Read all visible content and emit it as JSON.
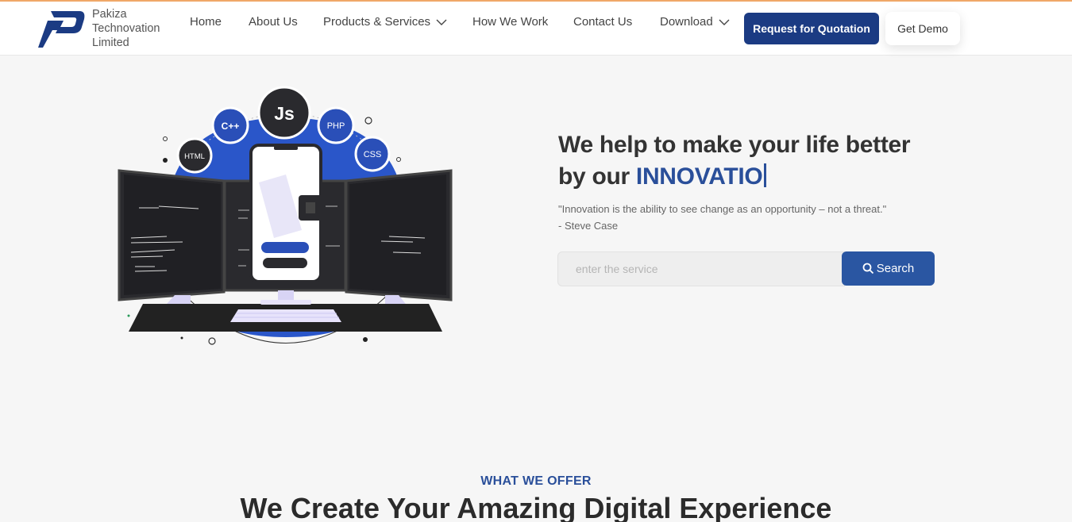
{
  "brand": {
    "name_line1": "Pakiza",
    "name_line2": "Technovation",
    "name_line3": "Limited",
    "logo_color": "#1b3b83"
  },
  "nav": {
    "items": [
      {
        "label": "Home"
      },
      {
        "label": "About Us"
      },
      {
        "label": "Products & Services",
        "dropdown": true
      },
      {
        "label": "How We Work"
      },
      {
        "label": "Contact Us"
      },
      {
        "label": "Download",
        "dropdown": true
      }
    ],
    "quote_button": "Request for Quotation",
    "demo_button": "Get Demo"
  },
  "hero": {
    "title_line1": "We help to make your life better",
    "title_line2_prefix": "by our ",
    "title_accent": "INNOVATIO",
    "quote_text": "\"Innovation is the ability to see change as an opportunity – not a threat.\"",
    "quote_author": "- Steve Case",
    "illustration": {
      "badges": [
        "Js",
        "C++",
        "PHP",
        "HTML",
        "CSS"
      ]
    }
  },
  "search": {
    "placeholder": "enter the service",
    "value": "",
    "button_label": "Search"
  },
  "offer": {
    "label": "WHAT WE OFFER",
    "title": "We Create Your Amazing Digital Experience"
  },
  "colors": {
    "primary": "#1b3b83",
    "accent": "#2a4f9a",
    "search_button": "#2a56a2",
    "top_line": "#f0a868"
  }
}
